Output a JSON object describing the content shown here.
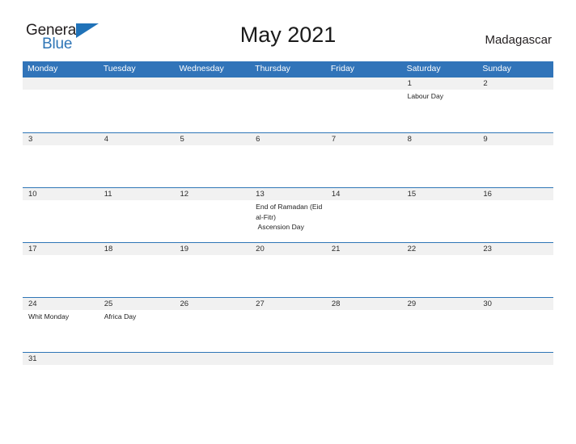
{
  "brand": {
    "name_part1": "General",
    "name_part2": "Blue",
    "flag_icon": "triangle-flag-icon"
  },
  "header": {
    "title": "May 2021",
    "country": "Madagascar"
  },
  "colors": {
    "header_blue": "#3174b9",
    "band_gray": "#f1f1f1",
    "rule_blue": "#2e75b6",
    "logo_blue": "#2072b8",
    "text_dark": "#1f1f1f"
  },
  "calendar": {
    "weekdays": [
      "Monday",
      "Tuesday",
      "Wednesday",
      "Thursday",
      "Friday",
      "Saturday",
      "Sunday"
    ],
    "weeks": [
      {
        "dates": [
          "",
          "",
          "",
          "",
          "",
          "1",
          "2"
        ],
        "events": [
          "",
          "",
          "",
          "",
          "",
          "Labour Day",
          ""
        ]
      },
      {
        "dates": [
          "3",
          "4",
          "5",
          "6",
          "7",
          "8",
          "9"
        ],
        "events": [
          "",
          "",
          "",
          "",
          "",
          "",
          ""
        ]
      },
      {
        "dates": [
          "10",
          "11",
          "12",
          "13",
          "14",
          "15",
          "16"
        ],
        "events": [
          "",
          "",
          "",
          "End of Ramadan (Eid al-Fitr)\n Ascension Day",
          "",
          "",
          ""
        ]
      },
      {
        "dates": [
          "17",
          "18",
          "19",
          "20",
          "21",
          "22",
          "23"
        ],
        "events": [
          "",
          "",
          "",
          "",
          "",
          "",
          ""
        ]
      },
      {
        "dates": [
          "24",
          "25",
          "26",
          "27",
          "28",
          "29",
          "30"
        ],
        "events": [
          "Whit Monday",
          "Africa Day",
          "",
          "",
          "",
          "",
          ""
        ]
      },
      {
        "dates": [
          "31",
          "",
          "",
          "",
          "",
          "",
          ""
        ],
        "events": [
          "",
          "",
          "",
          "",
          "",
          "",
          ""
        ]
      }
    ]
  }
}
